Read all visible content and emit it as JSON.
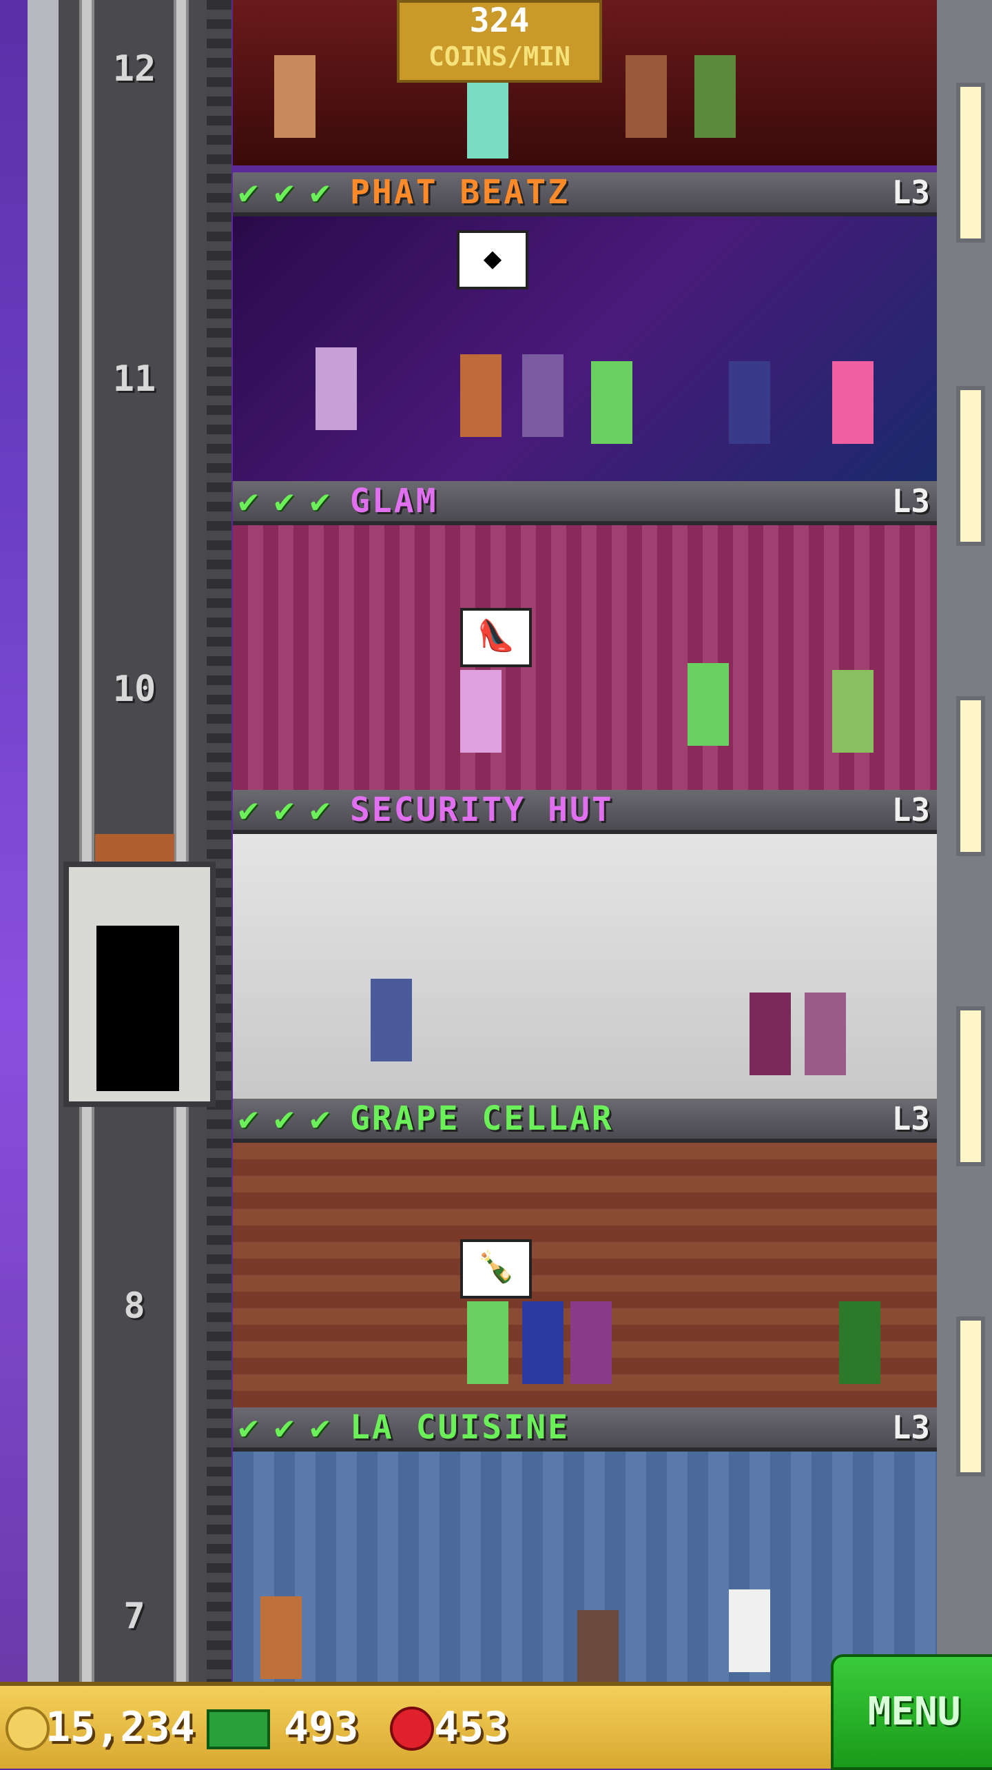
{
  "header": {
    "coins_rate_value": "324",
    "coins_rate_unit": "COINS/MIN"
  },
  "floor_numbers": [
    "12",
    "11",
    "10",
    "8",
    "7"
  ],
  "floors": [
    {
      "name": "PHAT BEATZ",
      "level": "L3",
      "name_color": "#ff8a2a",
      "bubble": "◆"
    },
    {
      "name": "GLAM",
      "level": "L3",
      "name_color": "#e070f0",
      "bubble": "👠"
    },
    {
      "name": "SECURITY HUT",
      "level": "L3",
      "name_color": "#e070f0",
      "bubble": ""
    },
    {
      "name": "GRAPE CELLAR",
      "level": "L3",
      "name_color": "#6cf05a",
      "bubble": "🍾"
    },
    {
      "name": "LA CUISINE",
      "level": "L3",
      "name_color": "#6cf05a",
      "bubble": ""
    }
  ],
  "bottom_bar": {
    "coins": "15,234",
    "bux": "493",
    "points": "453",
    "menu_label": "MENU"
  }
}
